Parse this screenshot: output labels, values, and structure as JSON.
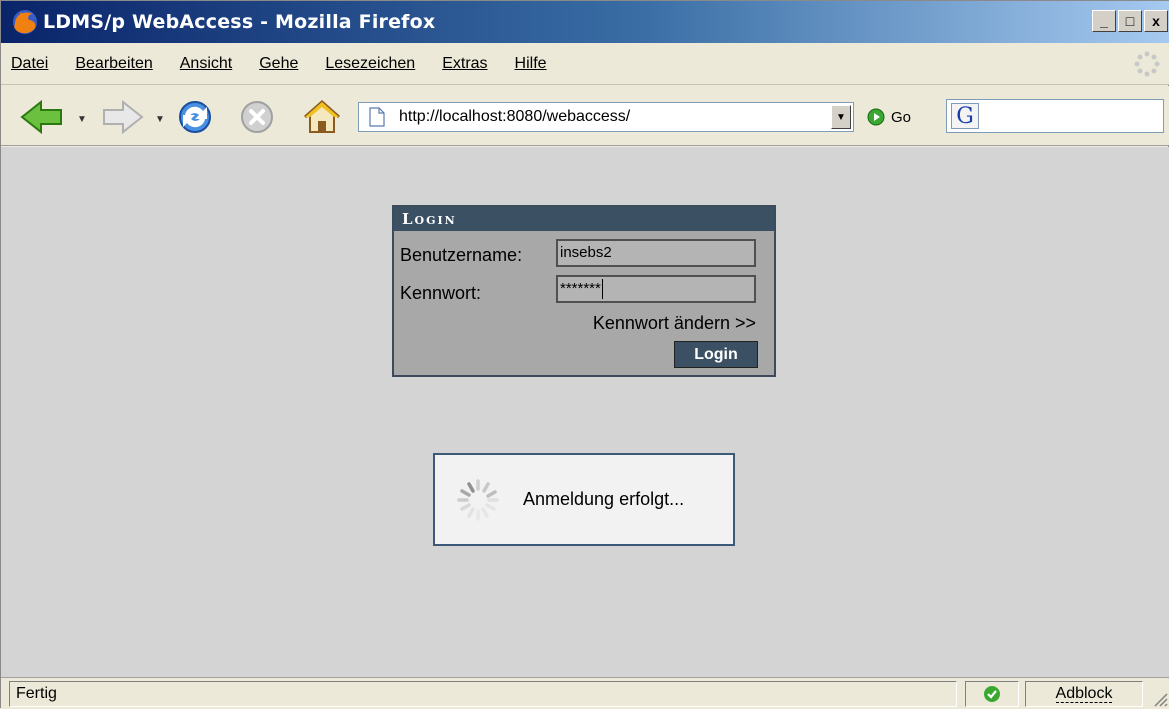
{
  "window": {
    "title": "LDMS/p WebAccess - Mozilla Firefox",
    "buttons": {
      "minimize": "_",
      "maximize": "□",
      "close": "x"
    }
  },
  "menu": {
    "items": [
      {
        "label": "Datei"
      },
      {
        "label": "Bearbeiten"
      },
      {
        "label": "Ansicht"
      },
      {
        "label": "Gehe"
      },
      {
        "label": "Lesezeichen"
      },
      {
        "label": "Extras"
      },
      {
        "label": "Hilfe"
      }
    ]
  },
  "toolbar": {
    "url": "http://localhost:8080/webaccess/",
    "go_label": "Go",
    "search_engine_icon": "G"
  },
  "login": {
    "header": "Login",
    "username_label": "Benutzername:",
    "username_value": "insebs2",
    "password_label": "Kennwort:",
    "password_value": "*******",
    "change_password_link": "Kennwort ändern >>",
    "login_button": "Login"
  },
  "progress": {
    "text": "Anmeldung erfolgt..."
  },
  "statusbar": {
    "status_text": "Fertig",
    "adblock_label": "Adblock"
  },
  "colors": {
    "titlebar_start": "#0a246a",
    "content_bg": "#d4d4d4",
    "login_header": "#3c5064",
    "progress_border": "#3c5a78"
  }
}
